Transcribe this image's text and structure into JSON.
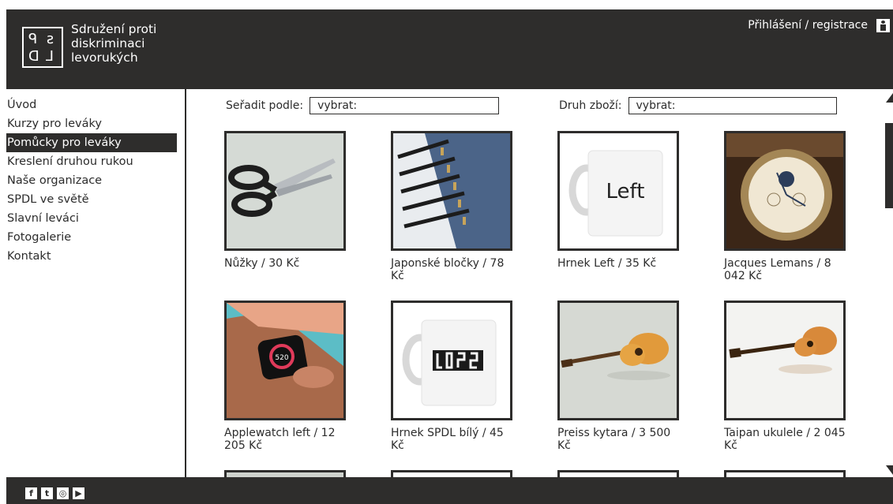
{
  "header": {
    "logo_letters": [
      "ᑫ",
      "ƨ",
      "ᗡ",
      "⅃"
    ],
    "logo_text": "Sdružení proti diskriminaci levorukých",
    "login": "Přihlášení / registrace"
  },
  "nav": [
    {
      "label": "Úvod",
      "active": false
    },
    {
      "label": "Kurzy pro leváky",
      "active": false
    },
    {
      "label": "Pomůcky pro leváky",
      "active": true
    },
    {
      "label": "Kreslení druhou rukou",
      "active": false
    },
    {
      "label": "Naše organizace",
      "active": false
    },
    {
      "label": "SPDL ve světě",
      "active": false
    },
    {
      "label": "Slavní leváci",
      "active": false
    },
    {
      "label": "Fotogalerie",
      "active": false
    },
    {
      "label": "Kontakt",
      "active": false
    }
  ],
  "filters": {
    "sort_label": "Seřadit podle:",
    "sort_value": "vybrat:",
    "type_label": "Druh zboží:",
    "type_value": "vybrat:"
  },
  "products": [
    {
      "caption": "Nůžky / 30 Kč",
      "image": "scissors"
    },
    {
      "caption": "Japonské bločky / 78 Kč",
      "image": "notebooks"
    },
    {
      "caption": "Hrnek Left / 35 Kč",
      "image": "mug-left",
      "mug_text": "Left"
    },
    {
      "caption": "Jacques Lemans / 8 042 Kč",
      "image": "watch"
    },
    {
      "caption": "Applewatch left / 12 205 Kč",
      "image": "smartwatch",
      "watch_text": "520"
    },
    {
      "caption": "Hrnek SPDL bílý / 45 Kč",
      "image": "mug-spdl"
    },
    {
      "caption": "Preiss kytara / 3 500 Kč",
      "image": "guitar"
    },
    {
      "caption": "Taipan ukulele / 2 045 Kč",
      "image": "ukulele"
    }
  ],
  "footer": {
    "social": [
      {
        "icon": "facebook-icon",
        "glyph": "f"
      },
      {
        "icon": "twitter-icon",
        "glyph": "t"
      },
      {
        "icon": "instagram-icon",
        "glyph": "◎"
      },
      {
        "icon": "youtube-icon",
        "glyph": "▶"
      }
    ]
  }
}
